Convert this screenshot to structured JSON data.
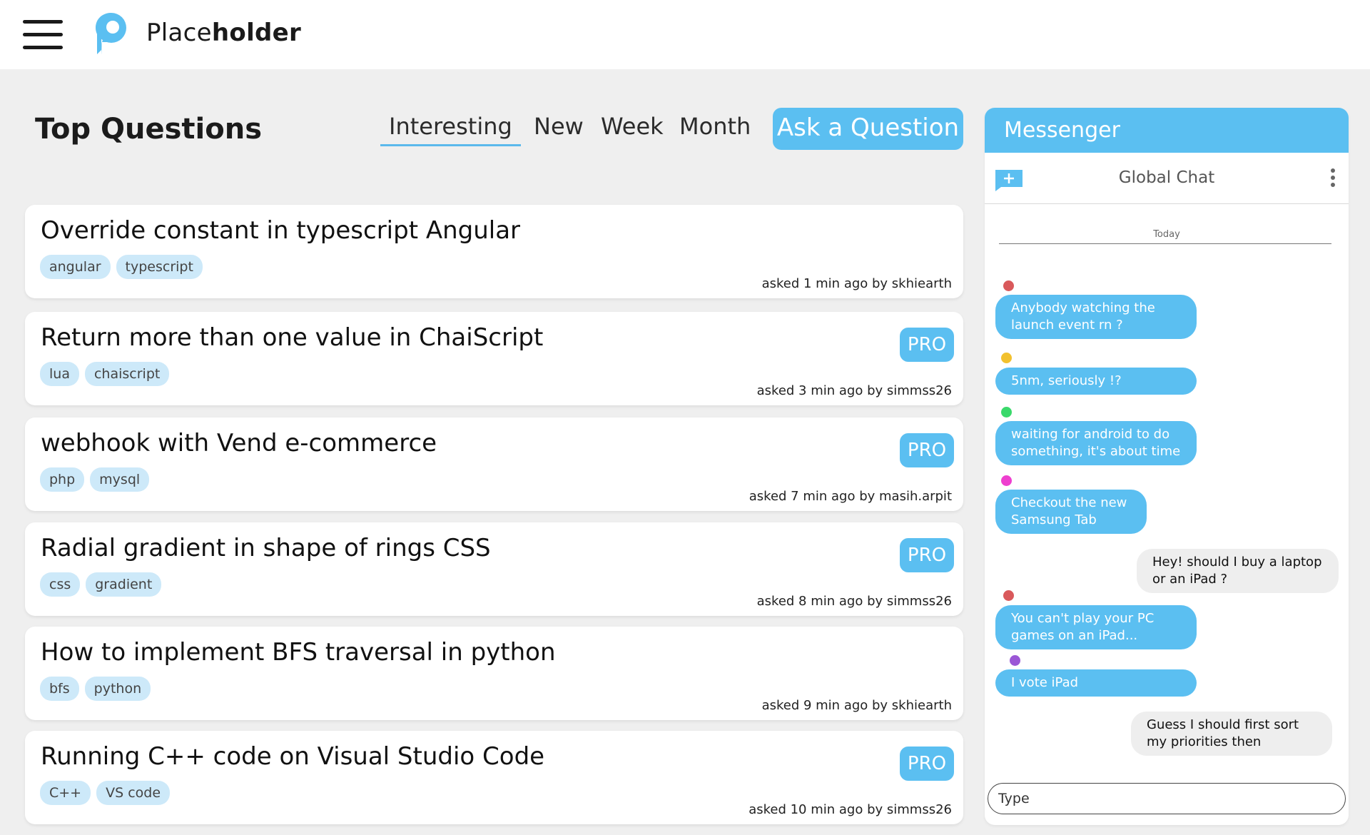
{
  "app": {
    "brand_regular": "Place",
    "brand_bold": "holder"
  },
  "main": {
    "title": "Top Questions",
    "tabs": [
      "Interesting",
      "New",
      "Week",
      "Month"
    ],
    "active_tab": "Interesting",
    "ask_button": "Ask a Question"
  },
  "questions": [
    {
      "title": "Override constant in typescript Angular",
      "tags": [
        "angular",
        "typescript"
      ],
      "pro": "",
      "asked": "asked 1 min ago by skhiearth"
    },
    {
      "title": "Return more than one value in ChaiScript",
      "tags": [
        "lua",
        "chaiscript"
      ],
      "pro": "PRO",
      "asked": "asked 3 min ago by simmss26"
    },
    {
      "title": "webhook with Vend e-commerce",
      "tags": [
        "php",
        "mysql"
      ],
      "pro": "PRO",
      "asked": "asked 7 min ago by masih.arpit"
    },
    {
      "title": "Radial gradient in shape of rings CSS",
      "tags": [
        "css",
        "gradient"
      ],
      "pro": "PRO",
      "asked": "asked 8 min ago by simmss26"
    },
    {
      "title": "How to implement BFS traversal in python",
      "tags": [
        "bfs",
        "python"
      ],
      "pro": "",
      "asked": "asked 9 min ago by skhiearth"
    },
    {
      "title": "Running C++ code on Visual Studio Code",
      "tags": [
        "C++",
        "VS code"
      ],
      "pro": "PRO",
      "asked": "asked 10 min ago by simmss26"
    }
  ],
  "messenger": {
    "title": "Messenger",
    "chat_name": "Global Chat",
    "date_divider": "Today",
    "input_placeholder": "Type",
    "messages": [
      {
        "text": "Anybody watching the launch event rn ?",
        "mine": false,
        "user_color": "#d9595b"
      },
      {
        "text": "5nm, seriously !?",
        "mine": false,
        "user_color": "#f2c12e"
      },
      {
        "text": "waiting for android to do something, it's about time",
        "mine": false,
        "user_color": "#3ad96b"
      },
      {
        "text": "Checkout the new Samsung Tab",
        "mine": false,
        "user_color": "#ee3fcf"
      },
      {
        "text": "Hey! should I buy a laptop or an iPad ?",
        "mine": true,
        "user_color": ""
      },
      {
        "text": "You can't play your PC games on an iPad...",
        "mine": false,
        "user_color": "#d9595b"
      },
      {
        "text": "I vote iPad",
        "mine": false,
        "user_color": "#9b57d6"
      },
      {
        "text": "Guess I should first sort my priorities then",
        "mine": true,
        "user_color": ""
      }
    ]
  },
  "colors": {
    "accent": "#5bbff1",
    "tag_bg": "#cde9f9",
    "background": "#efefef"
  }
}
